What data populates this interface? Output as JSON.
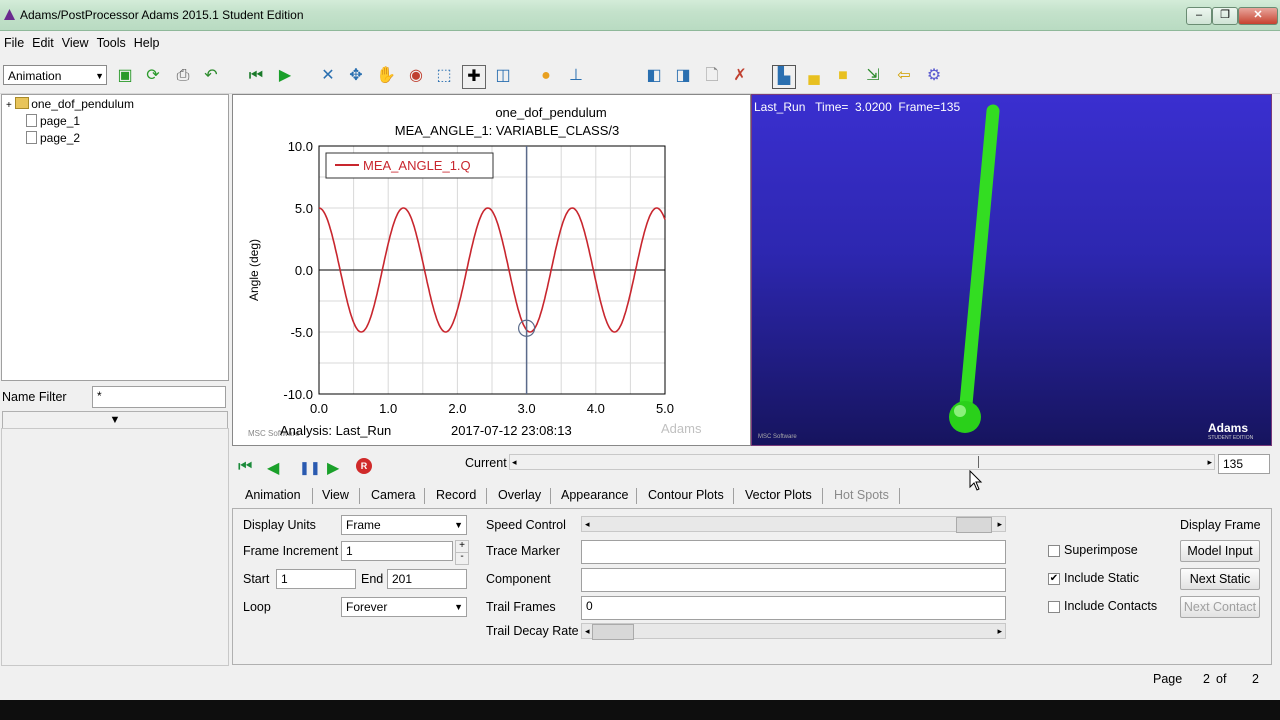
{
  "window": {
    "title": "Adams/PostProcessor Adams 2015.1 Student Edition",
    "minimize": "–",
    "restore": "❐",
    "close": "✕"
  },
  "menu": [
    "File",
    "Edit",
    "View",
    "Tools",
    "Help"
  ],
  "toolbar": {
    "mode_select": "Animation",
    "mode_arrow": "▼"
  },
  "tree": {
    "root": "one_dof_pendulum",
    "expander": "+",
    "pages": [
      "page_1",
      "page_2"
    ]
  },
  "name_filter": {
    "label": "Name Filter",
    "value": "*",
    "arrow": "▼"
  },
  "plot": {
    "title": "one_dof_pendulum",
    "subtitle": "MEA_ANGLE_1: VARIABLE_CLASS/3",
    "ylabel": "Angle (deg)",
    "legend": "MEA_ANGLE_1.Q",
    "footer_left": "Analysis:  Last_Run",
    "footer_right": "2017-07-12 23:08:13",
    "watermark_left": "MSC Software",
    "watermark_right": "Adams"
  },
  "chart_data": {
    "type": "line",
    "title": "one_dof_pendulum",
    "subtitle": "MEA_ANGLE_1: VARIABLE_CLASS/3",
    "xlabel": "",
    "ylabel": "Angle (deg)",
    "xlim": [
      0.0,
      5.0
    ],
    "ylim": [
      -10.0,
      10.0
    ],
    "x_ticks": [
      "0.0",
      "1.0",
      "2.0",
      "3.0",
      "4.0",
      "5.0"
    ],
    "y_ticks": [
      "10.0",
      "5.0",
      "0.0",
      "-5.0",
      "-10.0"
    ],
    "grid": true,
    "series": [
      {
        "name": "MEA_ANGLE_1.Q",
        "color": "#c8262e",
        "amplitude": 5.0,
        "period": 1.22,
        "x_start": 0.0,
        "x_end": 5.0
      }
    ],
    "cursor": {
      "x": 3.0,
      "y": -4.7
    }
  },
  "animation_view": {
    "overlay": "Last_Run   Time=  3.0200  Frame=135",
    "watermark_left": "MSC Software",
    "watermark_right": "Adams",
    "watermark_right_sub": "STUDENT EDITION",
    "pendulum_color": "#33dd22"
  },
  "anim_controls": {
    "current_label": "Current",
    "frame_value": "135",
    "slider_left": "◂",
    "slider_right": "▸",
    "rewind": "⏮",
    "play_back": "◀",
    "pause": "❚❚",
    "play": "▶",
    "record": "R",
    "progress": 0.67
  },
  "tabs": [
    "Animation",
    "View",
    "Camera",
    "Record",
    "Overlay",
    "Appearance",
    "Contour Plots",
    "Vector Plots",
    "Hot Spots"
  ],
  "form": {
    "display_units_label": "Display Units",
    "display_units_value": "Frame",
    "frame_increment_label": "Frame Increment",
    "frame_increment_value": "1",
    "start_label": "Start",
    "start_value": "1",
    "end_label": "End",
    "end_value": "201",
    "loop_label": "Loop",
    "loop_value": "Forever",
    "speed_control_label": "Speed Control",
    "trace_marker_label": "Trace Marker",
    "trace_marker_value": "",
    "component_label": "Component",
    "component_value": "",
    "trail_frames_label": "Trail Frames",
    "trail_frames_value": "0",
    "trail_decay_label": "Trail Decay Rate",
    "superimpose_label": "Superimpose",
    "superimpose_checked": false,
    "include_static_label": "Include Static",
    "include_static_checked": true,
    "include_contacts_label": "Include Contacts",
    "include_contacts_checked": false,
    "display_frame_label": "Display Frame",
    "model_input_button": "Model Input",
    "next_static_button": "Next Static",
    "next_contact_button": "Next Contact",
    "spin_up": "+",
    "spin_down": "-",
    "dropdown_arrow": "▼",
    "check_mark": "✔"
  },
  "status": {
    "page_label": "Page",
    "page_current": "2",
    "of_label": "of",
    "page_total": "2"
  }
}
